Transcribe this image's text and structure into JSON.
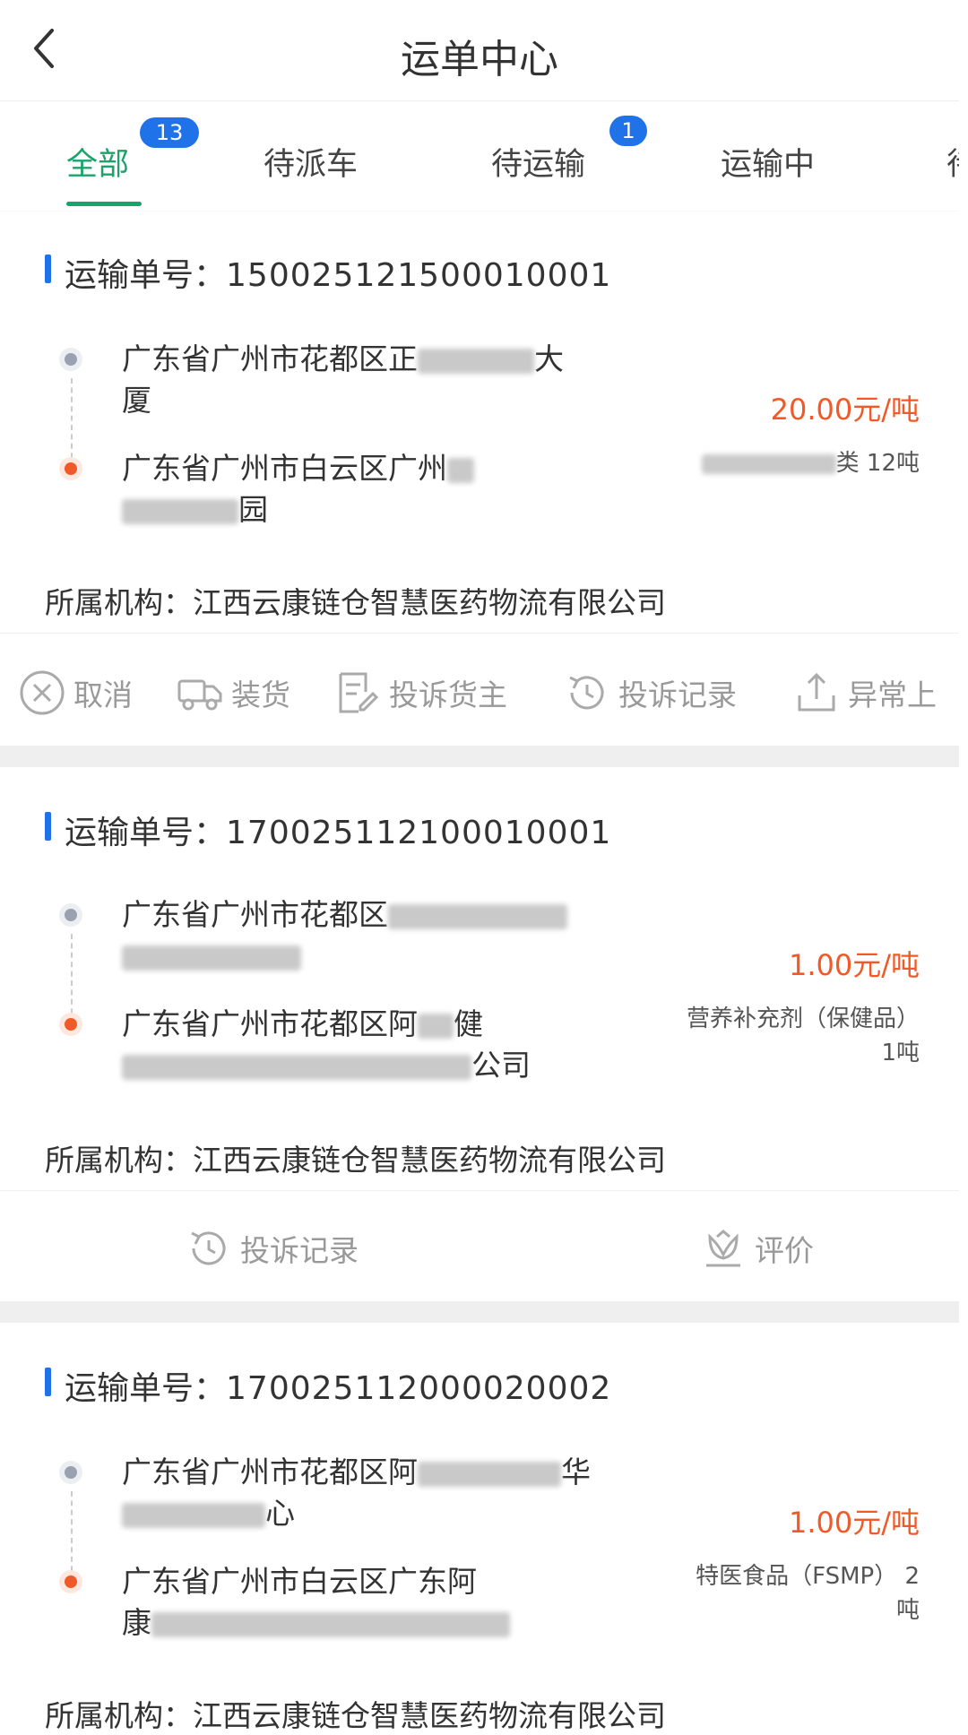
{
  "header": {
    "title": "运单中心"
  },
  "tabs": [
    {
      "label": "全部",
      "badge": "13"
    },
    {
      "label": "待派车"
    },
    {
      "label": "待运输",
      "badge": "1"
    },
    {
      "label": "运输中"
    },
    {
      "label": "待"
    }
  ],
  "colors": {
    "accent_green": "#1aa36a",
    "badge_blue": "#1f72e8",
    "price_orange": "#f05a28"
  },
  "orders": [
    {
      "order_label": "运输单号：",
      "order_no": "15002512150001000​1",
      "from_a": "广东省广州市花都区正",
      "from_b": "大",
      "from_c": "厦",
      "to_a": "广东省广州市白云区广州",
      "to_b": "园",
      "price": "20.00元/吨",
      "cargo_a": "类 12吨",
      "org": "所属机构：江西云康链仓智慧医药物流有限公司",
      "actions": [
        "取消",
        "装货",
        "投诉货主",
        "投诉记录",
        "异常上"
      ]
    },
    {
      "order_label": "运输单号：",
      "order_no": "170025112100010001",
      "from_a": "广东省广州市花都区",
      "to_a": "广东省广州市花都区阿",
      "to_b": "健",
      "to_c": "公司",
      "price": "1.00元/吨",
      "cargo_a": "营养补充剂（保健品）",
      "cargo_b": "1吨",
      "org": "所属机构：江西云康链仓智慧医药物流有限公司",
      "actions": [
        "投诉记录",
        "评价"
      ]
    },
    {
      "order_label": "运输单号：",
      "order_no": "170025112000020002",
      "from_a": "广东省广州市花都区阿",
      "from_b": "华",
      "from_c": "心",
      "to_a": "广东省广州市白云区广东阿",
      "to_b": "康",
      "price": "1.00元/吨",
      "cargo_a": "特医食品（FSMP） 2",
      "cargo_b": "吨",
      "org": "所属机构：江西云康链仓智慧医药物流有限公司"
    }
  ]
}
